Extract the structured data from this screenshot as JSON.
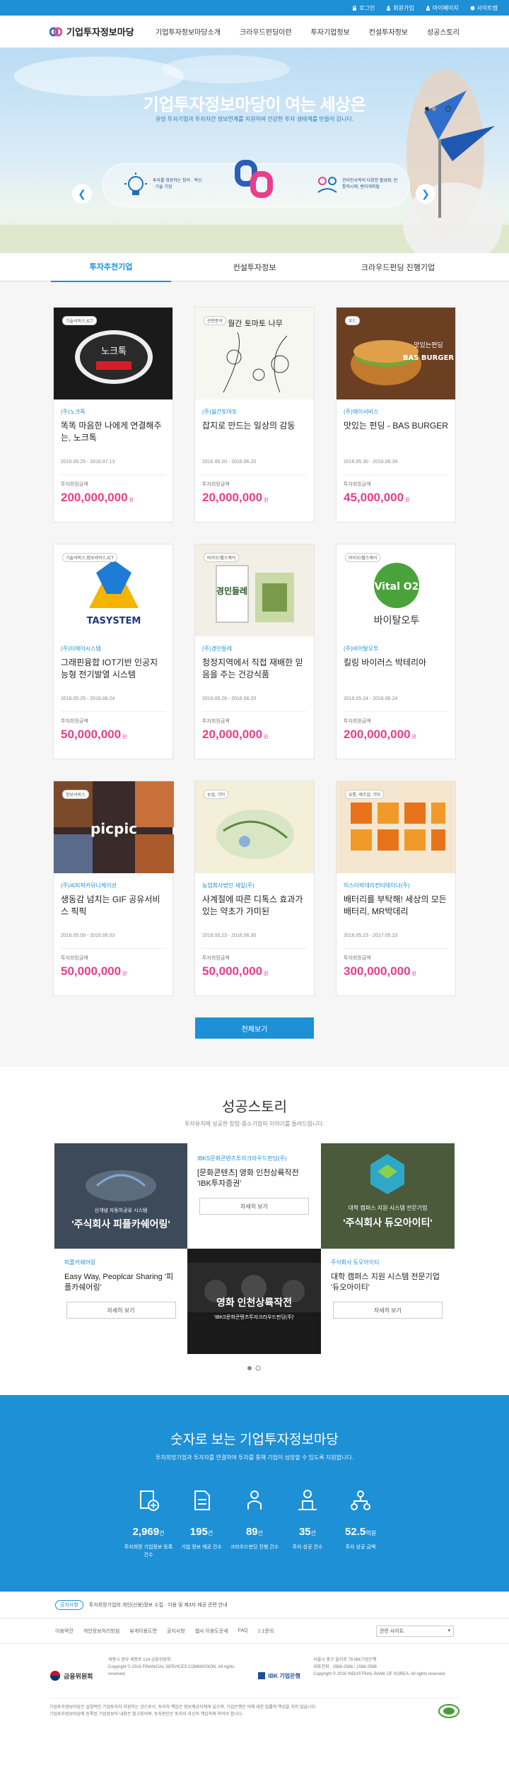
{
  "topbar": {
    "items": [
      "로그인",
      "회원가입",
      "마이페이지",
      "사이트맵"
    ]
  },
  "header": {
    "logo": "기업투자정보마당",
    "nav": [
      "기업투자정보마당소개",
      "크라우드펀딩이란",
      "투자기업정보",
      "컨설투자정보",
      "성공스토리"
    ]
  },
  "hero": {
    "title_a": "기업투자정보마당",
    "title_b": "이 여는 세상은",
    "subtitle": "유망 투자기업과 투자자간 정보연계를 지원하여 건강한 투자 생태계를 만들어 갑니다.",
    "left_text": "투자를 희망하는 창의 · 혁신 · 기술 기업",
    "right_text": "관리인사적의 다양한 활성화, 빈틈적시해, 벤처캐피탈"
  },
  "tabs": [
    "투자추천기업",
    "컨설투자정보",
    "크라우드펀딩 진행기업"
  ],
  "cards": [
    {
      "tag": "기술서비스,ICT",
      "company": "(주)노크톡",
      "title": "똑똑 마음한 나에게 연결해주는, 노크톡",
      "period": "2016.05.25 - 2016.07.13",
      "label": "투자희망금액",
      "amount": "200,000,000",
      "unit": "원"
    },
    {
      "tag": "관련분야",
      "company": "(주)월간토마토",
      "title": "잡지로 만드는 일상의 감동",
      "period": "2016.05.20 - 2016.06.20",
      "label": "투자희망금액",
      "amount": "20,000,000",
      "unit": "원"
    },
    {
      "tag": "푸드",
      "company": "(주)에이서비스",
      "title": "맛있는 펀딩 - BAS BURGER",
      "period": "2016.05.30 - 2016.06.39",
      "label": "투자희망금액",
      "amount": "45,000,000",
      "unit": "원"
    },
    {
      "tag": "기술서비스,정보서비스,ICT",
      "company": "(주)티에이시스템",
      "title": "그래핀융합 IOT기반 인공지능형 전기발열 시스템",
      "period": "2016.05.25 - 2016.06.24",
      "label": "투자희망금액",
      "amount": "50,000,000",
      "unit": "원"
    },
    {
      "tag": "바이오/헬스케어",
      "company": "(주)경민들레",
      "title": "청정지역에서 직접 재배한 믿음을 주는 건강식품",
      "period": "2016.05.26 - 2016.06.20",
      "label": "투자희망금액",
      "amount": "20,000,000",
      "unit": "원"
    },
    {
      "tag": "바이오/헬스케어",
      "company": "(주)바이탈오투",
      "title": "킬링 바이러스 박테리아",
      "period": "2016.05.24 - 2016.06.24",
      "label": "투자희망금액",
      "amount": "200,000,000",
      "unit": "원"
    },
    {
      "tag": "정보서비스",
      "company": "(주)씨피픽커뮤니케이션",
      "title": "생동감 넘치는 GIF 공유서비스 픽픽",
      "period": "2016.05.09 - 2016.06.03",
      "label": "투자희망금액",
      "amount": "50,000,000",
      "unit": "원"
    },
    {
      "tag": "농업, 기타",
      "company": "농업회사법인 새잎(주)",
      "title": "사계절에 따른 디톡스 효과가 있는 약초가 가미된",
      "period": "2016.05.23 - 2016.06.30",
      "label": "투자희망금액",
      "amount": "50,000,000",
      "unit": "원"
    },
    {
      "tag": "유통, 제조업, 기타",
      "company": "미스터박데리컨터테이너(주)",
      "title": "배터리를 부탁해! 세상의 모든 배터리, MR박데리",
      "period": "2016.05.23 - 2017.05.23",
      "label": "투자희망금액",
      "amount": "300,000,000",
      "unit": "원"
    }
  ],
  "thumbs": {
    "t1": "노크톡",
    "t2": "월간 토마토 나무",
    "t3": "BAS BURGER",
    "t3b": "맛있는펀딩",
    "t4": "TASYSTEM",
    "t5": "경민들레",
    "t6": "Vital O2",
    "t6b": "바이탈오투",
    "t7": "picpic"
  },
  "all_button": "전체보기",
  "story": {
    "title": "성공스토리",
    "subtitle": "투자유치에 성공한 창업·중소기업의 이야기를 들려드립니다.",
    "c1_overlay_small": "신개념 자동차공유 시스템",
    "c1_overlay": "'주식회사 피플카쉐어링'",
    "c2_company": "IBKS문화콘텐츠투자크라우드펀딩(주)",
    "c2_title": "[문화콘텐츠] 영화 인천상륙작전 'IBK투자증권'",
    "c2_btn": "자세히 보기",
    "c3_overlay_small": "대학 캠퍼스 지원 시스템 전문기업",
    "c3_overlay": "'주식회사 듀오아이티'",
    "c4_company": "피플카쉐어링",
    "c4_title": "Easy Way, Peoplcar Sharing '피플카쉐어링'",
    "c4_btn": "자세히 보기",
    "c5_overlay": "영화 인천상륙작전",
    "c5_overlay_small": "'IBKS문화콘텐츠투자크라우드펀딩(주)'",
    "c6_company": "주식회사 듀오아이티",
    "c6_title": "대학 캠퍼스 지원 시스템 전문기업 '듀오아이티'",
    "c6_btn": "자세히 보기"
  },
  "numbers": {
    "title": "숫자로 보는 기업투자정보마당",
    "subtitle": "투자희망기업과 투자자를 연결하여 투자를 통해 기업이 성장할 수 있도록 지원합니다.",
    "stats": [
      {
        "num": "2,969",
        "unit": "건",
        "label": "투자희망 기업정보 등록 건수"
      },
      {
        "num": "195",
        "unit": "건",
        "label": "기업 정보 제공 건수"
      },
      {
        "num": "89",
        "unit": "건",
        "label": "크라우드펀딩 진행 건수"
      },
      {
        "num": "35",
        "unit": "건",
        "label": "투자 성공 건수"
      },
      {
        "num": "52.5",
        "unit": "억원",
        "label": "투자 성공 금액"
      }
    ]
  },
  "notice": {
    "pill": "공지사항",
    "text": "투자희망기업의 개인(신용)정보 수집 · 이용 및 제3자 제공 관련 안내"
  },
  "footer": {
    "links": [
      "이용약관",
      "개인정보처리방침",
      "뷰게이용도면",
      "공지사항",
      "웹사 이용도운세",
      "FAQ",
      "1:1문의"
    ],
    "select": "관련 사이트",
    "fsc": "금융위원회",
    "fsc_addr": "세종시 정부 세종로 124 금융위원회",
    "fsc_copy": "Copyright © 2016 FINANCIAL SERVICES COMMISSION. All rights reserved.",
    "ibk": "IBK 기업은행",
    "ibk_addr": "서울시 중구 을지로 79 IBK기업은행",
    "ibk_tel": "대표전화 : 1566-2566 / 1588-2588",
    "ibk_copy": "Copyright © 2016 INDUSTRIAL BANK OF KOREA. All rights reserved.",
    "legal1": "기업투자정보마당은 실험적인 기업투자자 지원하는 것으로서, 투자자 책임은 정보제공자에게 있으며, 기업은행은 이에 대한 법률적 책임을 지지 않습니다.",
    "legal2": "기업투자정보마당에 등록된 기업정보의 내용은 참고용이며, 투자판단은 투자자 자신의 책임하에 하여야 합니다."
  },
  "colors": {
    "primary": "#1e90d6",
    "amount": "#e83e8c"
  }
}
